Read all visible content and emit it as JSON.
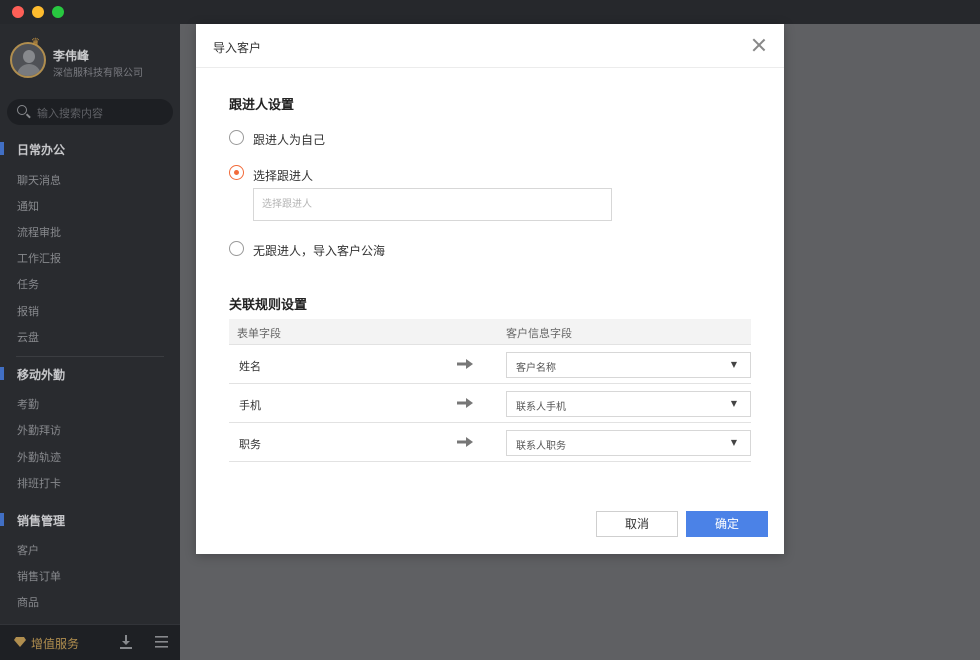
{
  "colors": {
    "accent": "#4b82e7",
    "radio_checked": "#f26b3a",
    "sidebar_bg": "#2f3136",
    "gold": "#c9a25a"
  },
  "profile": {
    "name": "李伟峰",
    "company": "深信服科技有限公司"
  },
  "search": {
    "placeholder": "输入搜索内容"
  },
  "sidebar": {
    "sections": [
      {
        "title": "日常办公",
        "items": [
          "聊天消息",
          "通知",
          "流程审批",
          "工作汇报",
          "任务",
          "报销",
          "云盘"
        ]
      },
      {
        "title": "移动外勤",
        "items": [
          "考勤",
          "外勤拜访",
          "外勤轨迹",
          "排班打卡"
        ]
      },
      {
        "title": "销售管理",
        "items": [
          "客户",
          "销售订单",
          "商品"
        ]
      }
    ],
    "footer": {
      "label": "增值服务"
    }
  },
  "modal": {
    "title": "导入客户",
    "follow_section": {
      "heading": "跟进人设置",
      "options": [
        "跟进人为自己",
        "选择跟进人",
        "无跟进人，导入客户公海"
      ],
      "selected_index": 1,
      "input_placeholder": "选择跟进人"
    },
    "rules_section": {
      "heading": "关联规则设置",
      "columns": [
        "表单字段",
        "客户信息字段"
      ],
      "rows": [
        {
          "field": "姓名",
          "mapped": "客户名称"
        },
        {
          "field": "手机",
          "mapped": "联系人手机"
        },
        {
          "field": "职务",
          "mapped": "联系人职务"
        }
      ]
    },
    "buttons": {
      "cancel": "取消",
      "ok": "确定"
    }
  }
}
